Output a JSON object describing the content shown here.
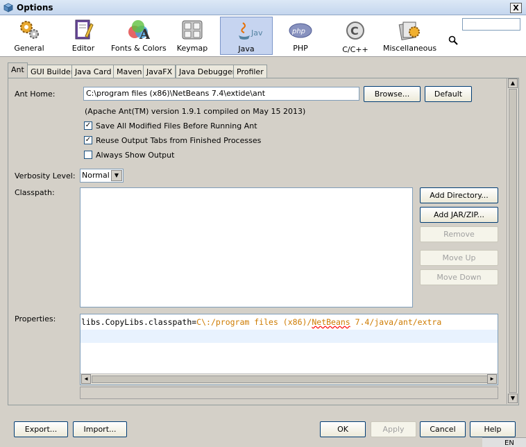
{
  "window": {
    "title": "Options",
    "close_glyph": "X"
  },
  "categories": [
    {
      "label": "General",
      "icon": "gears-icon"
    },
    {
      "label": "Editor",
      "icon": "editor-icon"
    },
    {
      "label": "Fonts & Colors",
      "icon": "fonts-colors-icon"
    },
    {
      "label": "Keymap",
      "icon": "keymap-icon"
    },
    {
      "label": "Java",
      "icon": "java-icon",
      "selected": true
    },
    {
      "label": "PHP",
      "icon": "php-icon"
    },
    {
      "label": "C/C++",
      "icon": "cpp-icon"
    },
    {
      "label": "Miscellaneous",
      "icon": "misc-icon"
    }
  ],
  "search": {
    "value": ""
  },
  "tabs": [
    "Ant",
    "GUI Builder",
    "Java Card",
    "Maven",
    "JavaFX",
    "Java Debugger",
    "Profiler"
  ],
  "ant": {
    "home_label": "Ant Home:",
    "home_value": "C:\\program files (x86)\\NetBeans 7.4\\extide\\ant",
    "browse_label": "Browse...",
    "default_label": "Default",
    "version_text": "(Apache Ant(TM) version 1.9.1 compiled on May 15 2013)",
    "checkboxes": [
      {
        "label": "Save All Modified Files Before Running Ant",
        "checked": true
      },
      {
        "label": "Reuse Output Tabs from Finished Processes",
        "checked": true
      },
      {
        "label": "Always Show Output",
        "checked": false
      }
    ],
    "verbosity_label": "Verbosity Level:",
    "verbosity_value": "Normal",
    "classpath_label": "Classpath:",
    "classpath_buttons": {
      "add_directory": "Add Directory...",
      "add_jar": "Add JAR/ZIP...",
      "remove": "Remove",
      "move_up": "Move Up",
      "move_down": "Move Down"
    },
    "properties_label": "Properties:",
    "properties_key": "libs.CopyLibs.classpath=",
    "properties_value_a": "C\\:/program files (x86)/",
    "properties_value_b": "NetBeans",
    "properties_value_c": " 7.4/java/ant/extra"
  },
  "footer": {
    "export": "Export...",
    "import": "Import...",
    "ok": "OK",
    "apply": "Apply",
    "cancel": "Cancel",
    "help": "Help"
  },
  "statusbar": {
    "lang": "EN"
  },
  "colors": {
    "accent": "#c6d4f0",
    "link_orange": "#ce7b00"
  }
}
